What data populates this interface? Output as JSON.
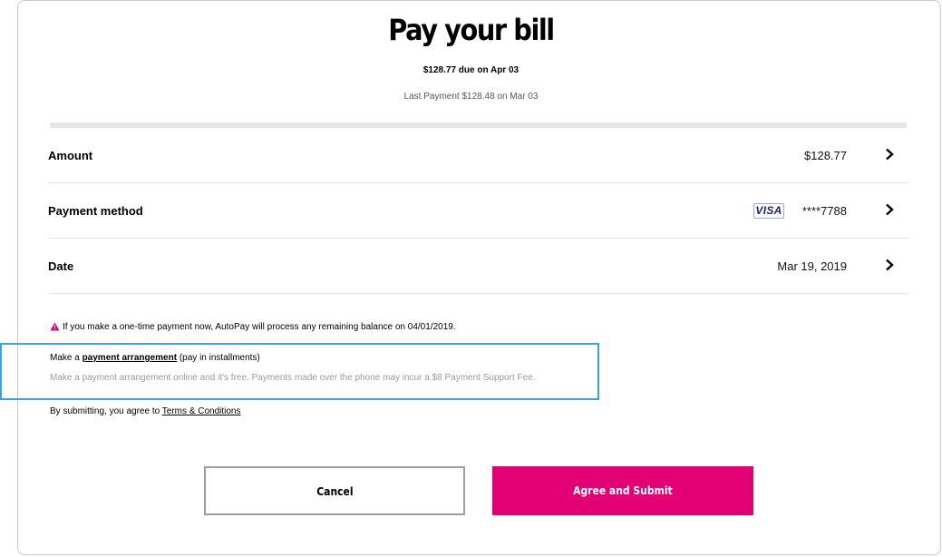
{
  "header": {
    "title": "Pay your bill",
    "due_text": "$128.77 due on Apr 03",
    "last_payment": "Last Payment $128.48 on Mar 03"
  },
  "rows": {
    "amount": {
      "label": "Amount",
      "value": "$128.77"
    },
    "payment_method": {
      "label": "Payment method",
      "card_brand": "VISA",
      "value": "****7788"
    },
    "date": {
      "label": "Date",
      "value": "Mar 19, 2019"
    }
  },
  "notice": {
    "icon": "warning-triangle-icon",
    "text": "If you make a one-time payment now, AutoPay will process any remaining balance on 04/01/2019."
  },
  "arrangement": {
    "prefix": "Make a ",
    "link": "payment arrangement",
    "suffix": " (pay in installments)",
    "note": "Make a payment arrangement online and it's free. Payments made over the phone may incur a $8 Payment Support Fee."
  },
  "terms": {
    "prefix": "By submitting, you agree to ",
    "link": "Terms & Conditions"
  },
  "buttons": {
    "cancel": "Cancel",
    "submit": "Agree and Submit"
  },
  "colors": {
    "accent": "#e20074",
    "highlight_border": "#3aa2e2",
    "visa_blue": "#1a1f71"
  }
}
